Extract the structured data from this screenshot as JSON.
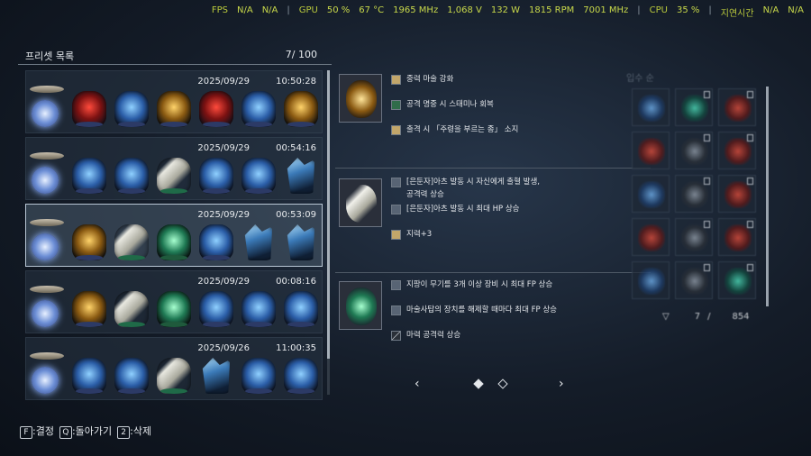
{
  "perf": {
    "fps_label": "FPS",
    "fps_value": "N/A",
    "fps_value2": "N/A",
    "gpu_label": "GPU",
    "gpu_usage": "50 %",
    "gpu_temp": "67 °C",
    "gpu_clock": "1965 MHz",
    "gpu_voltage": "1,068 V",
    "gpu_power": "132 W",
    "gpu_fan": "1815 RPM",
    "gpu_mem": "7001 MHz",
    "cpu_label": "CPU",
    "cpu_usage": "35 %",
    "latency_label": "지연시간",
    "latency_value": "N/A",
    "latency_value2": "N/A"
  },
  "preset_list": {
    "title": "프리셋 목록",
    "count": "7/ 100",
    "rows": [
      {
        "date": "2025/09/29",
        "time": "10:50:28",
        "slots": [
          "red",
          "blue",
          "gold",
          "red",
          "blue",
          "gold"
        ]
      },
      {
        "date": "2025/09/29",
        "time": "00:54:16",
        "slots": [
          "blue",
          "blue",
          "bone",
          "blue",
          "blue",
          "crystal"
        ]
      },
      {
        "date": "2025/09/29",
        "time": "00:53:09",
        "slots": [
          "gold",
          "bone",
          "green",
          "blue",
          "crystal",
          "crystal"
        ],
        "selected": true
      },
      {
        "date": "2025/09/29",
        "time": "00:08:16",
        "slots": [
          "gold",
          "bone",
          "green",
          "blue",
          "blue",
          "blue"
        ]
      },
      {
        "date": "2025/09/26",
        "time": "11:00:35",
        "slots": [
          "blue",
          "blue",
          "bone",
          "crystal",
          "blue",
          "blue"
        ]
      }
    ]
  },
  "detail": {
    "blocks": [
      {
        "icon": "gold-relic",
        "effects": [
          {
            "icon": "eye",
            "text": "중력 마술 강화"
          },
          {
            "icon": "shield",
            "text": "공격 명중 시 스태미나 회복"
          },
          {
            "icon": "eye",
            "text": "출격 시 「주령을 부르는 종」 소지"
          }
        ]
      },
      {
        "icon": "bone-relic",
        "effects": [
          {
            "icon": "rune",
            "text": "[은둔자]아츠 발동 시 자신에게 출혈 발생,"
          },
          {
            "icon": "none",
            "text": "공격력 상승"
          },
          {
            "icon": "rune",
            "text": "[은둔자]아츠 발동 시 최대 HP 상승"
          },
          {
            "icon": "eye",
            "text": "지력+3"
          }
        ]
      },
      {
        "icon": "green-relic",
        "effects": [
          {
            "icon": "rune",
            "text": "지팡이 무기를 3개 이상 장비 시 최대 FP 상승"
          },
          {
            "icon": "rune",
            "text": "마술사탑의 장치를 해제할 때마다 최대 FP 상승"
          },
          {
            "icon": "sword",
            "text": "마력 공격력 상승"
          }
        ]
      }
    ],
    "pager": {
      "prev": "‹",
      "next": "›",
      "pages": 2,
      "current": 1
    }
  },
  "inventory": {
    "title": "입수 순",
    "cells": [
      "blue",
      "teal",
      "red",
      "red",
      "gray",
      "red",
      "blue",
      "gray",
      "red",
      "red",
      "gray",
      "red",
      "blue",
      "gray",
      "teal"
    ],
    "owned": "7",
    "owned_sep": "/",
    "total": "854",
    "filter_icon": "funnel-icon"
  },
  "keys": [
    {
      "key": "F",
      "label": ":결정"
    },
    {
      "key": "Q",
      "label": ":돌아가기"
    },
    {
      "key": "2",
      "label": ":삭제"
    }
  ]
}
